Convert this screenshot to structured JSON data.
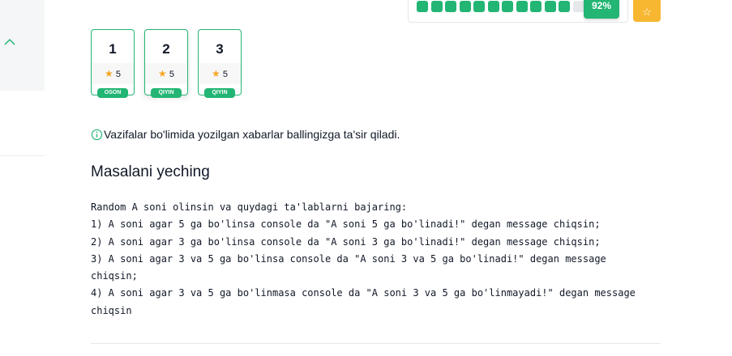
{
  "sidebar": {
    "collapse_icon": "chevron-up-icon"
  },
  "progress": {
    "segments_filled": 11,
    "segments_total": 12,
    "percent_label": "92%"
  },
  "star_button": {
    "icon": "star-icon",
    "label": "☆"
  },
  "variants": [
    {
      "number": "1",
      "score": "5",
      "difficulty": "OSON",
      "active": false
    },
    {
      "number": "2",
      "score": "5",
      "difficulty": "QIYIN",
      "active": true
    },
    {
      "number": "3",
      "score": "5",
      "difficulty": "QIYIN",
      "active": false
    }
  ],
  "info": {
    "icon": "info-icon",
    "text": "Vazifalar bo'limida yozilgan xabarlar ballingizga ta'sir qiladi."
  },
  "task": {
    "title": "Masalani yeching",
    "lines": [
      "Random A soni olinsin va quydagi ta'lablarni bajaring:",
      "1) A soni agar 5 ga bo'linsa console da \"A soni 5 ga bo'linadi!\" degan message chiqsin;",
      "2) A soni agar 3 ga bo'linsa console da \"A soni 3 ga bo'linadi!\" degan message chiqsin;",
      "3) A soni agar 3 va 5 ga bo'linsa console da \"A soni 3 va 5 ga bo'linadi!\" degan message chiqsin;",
      "4) A soni agar 3 va 5 ga bo'linmasa console da \"A soni 3 va 5 ga bo'linmayadi!\" degan message chiqsin"
    ]
  },
  "colors": {
    "accent": "#22b573",
    "star": "#f5a623",
    "star_button": "#f7b731"
  }
}
